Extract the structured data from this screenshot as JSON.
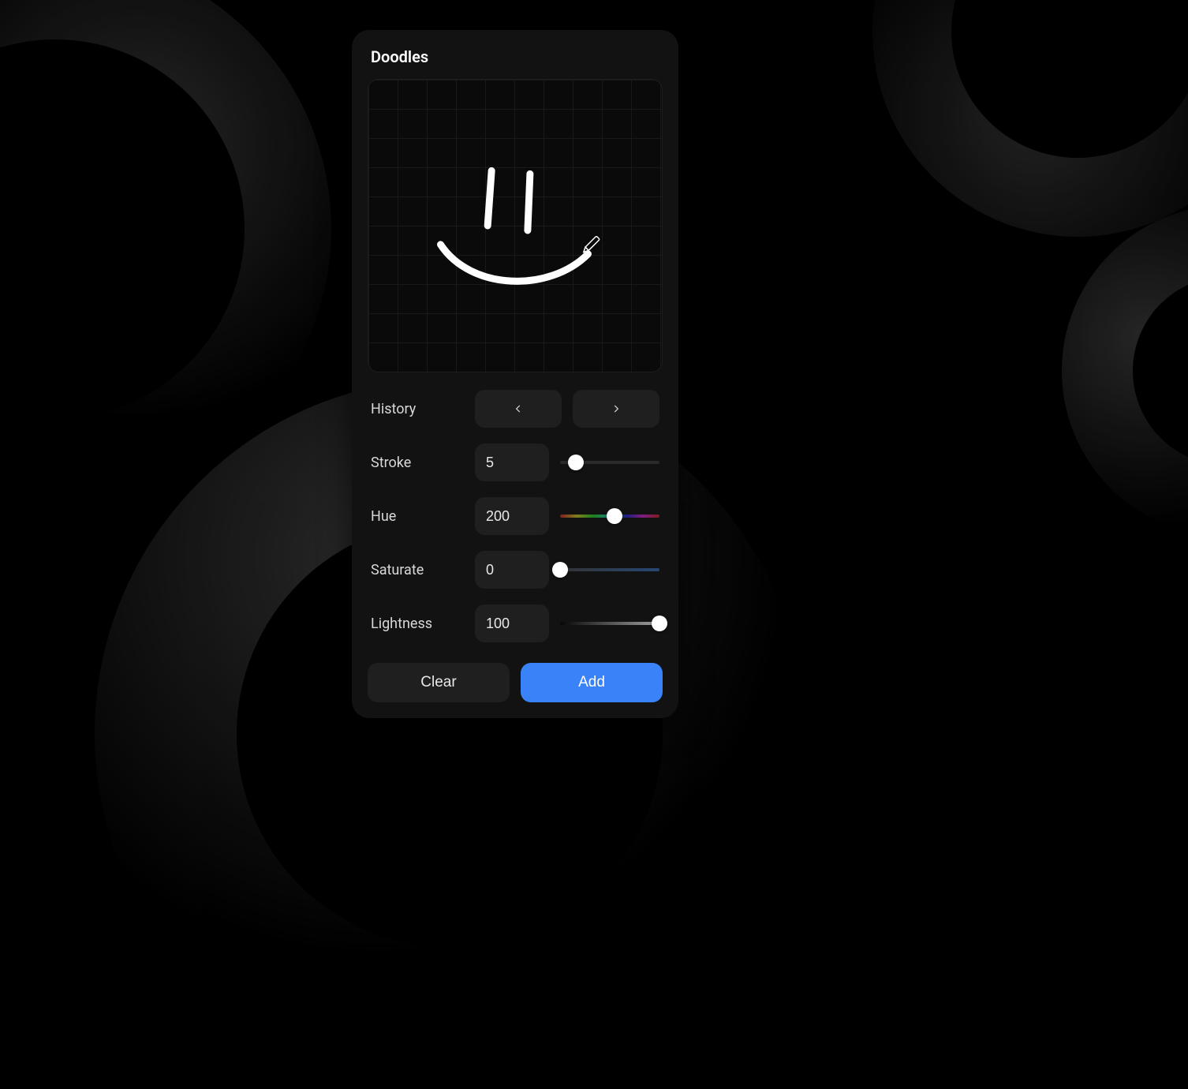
{
  "panel": {
    "title": "Doodles"
  },
  "controls": {
    "history": {
      "label": "History"
    },
    "stroke": {
      "label": "Stroke",
      "value": "5",
      "min": 1,
      "max": 50,
      "slider_percent": 16
    },
    "hue": {
      "label": "Hue",
      "value": "200",
      "min": 0,
      "max": 360,
      "slider_percent": 55
    },
    "saturate": {
      "label": "Saturate",
      "value": "0",
      "min": 0,
      "max": 100,
      "slider_percent": 0
    },
    "lightness": {
      "label": "Lightness",
      "value": "100",
      "min": 0,
      "max": 100,
      "slider_percent": 100
    }
  },
  "buttons": {
    "clear": "Clear",
    "add": "Add"
  },
  "icons": {
    "history_prev": "chevron-left-icon",
    "history_next": "chevron-right-icon",
    "pencil": "pencil-icon"
  }
}
